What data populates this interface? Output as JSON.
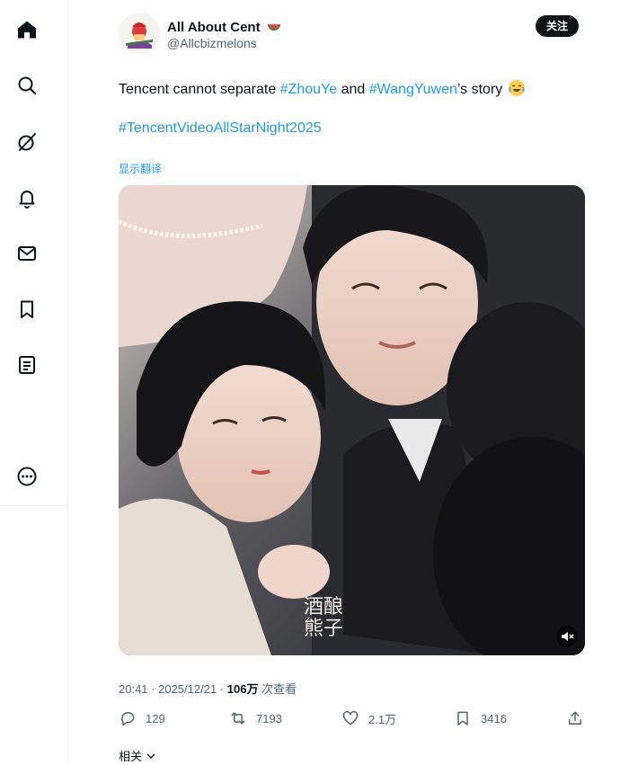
{
  "sidebar": {
    "items": [
      {
        "name": "home",
        "icon": "home-icon"
      },
      {
        "name": "explore",
        "icon": "search-icon"
      },
      {
        "name": "grok",
        "icon": "grok-icon"
      },
      {
        "name": "notifications",
        "icon": "bell-icon"
      },
      {
        "name": "messages",
        "icon": "mail-icon"
      },
      {
        "name": "bookmarks",
        "icon": "bookmark-icon"
      },
      {
        "name": "lists",
        "icon": "list-icon"
      },
      {
        "name": "more",
        "icon": "more-circle-icon"
      }
    ]
  },
  "post": {
    "author": {
      "display_name": "All About Cent",
      "handle": "@Allcbizmelons",
      "name_emoji": "watermelon"
    },
    "follow_label": "关注",
    "text_parts": [
      "Tencent cannot separate ",
      "#ZhouYe",
      " and ",
      "#WangYuwen",
      "’s story"
    ],
    "emoji": "laughing-crying",
    "hashtag_line": "#TencentVideoAllStarNight2025",
    "translate_label": "显示翻译",
    "media": {
      "watermark": "酒酿\n熊子"
    },
    "time": "20:41",
    "date": "2025/12/21",
    "sep": " · ",
    "views_count": "106万",
    "views_label": " 次查看",
    "stats": {
      "replies": "129",
      "reposts": "7193",
      "likes": "2.1万",
      "bookmarks": "3416"
    }
  },
  "related_label": "相关",
  "colors": {
    "accent": "#1d9bf0",
    "text": "#0f1419",
    "muted": "#536471",
    "border": "#eff3f4"
  }
}
